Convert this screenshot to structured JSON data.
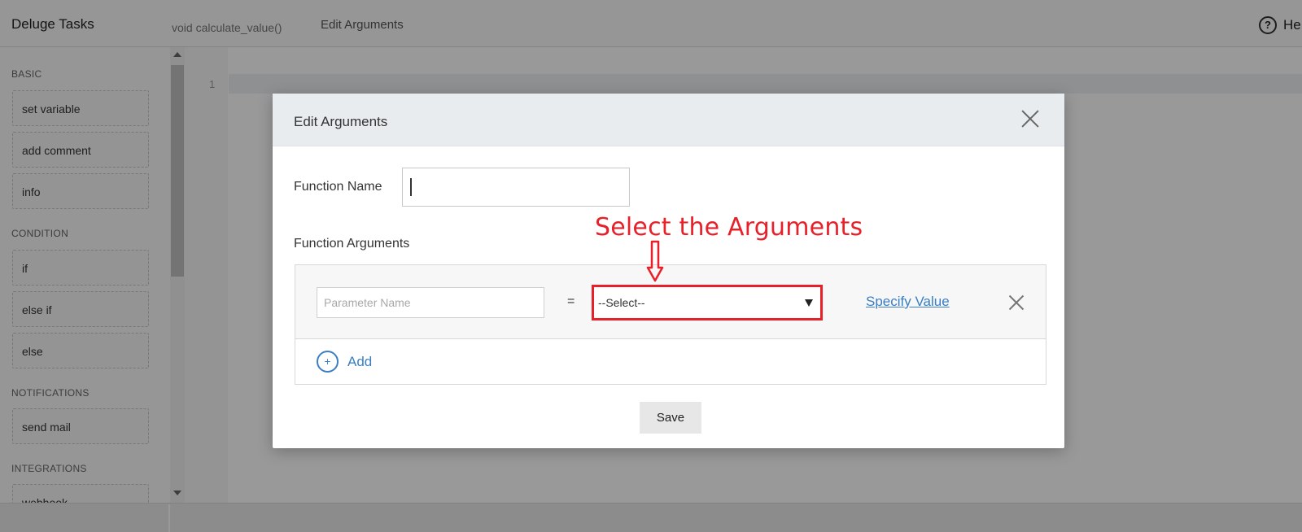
{
  "app": {
    "title": "Deluge Tasks",
    "function_signature": "void  calculate_value()",
    "active_tab": "Edit Arguments",
    "help_label": "He"
  },
  "sidebar": {
    "sections": [
      {
        "heading": "BASIC",
        "items": [
          "set variable",
          "add comment",
          "info"
        ]
      },
      {
        "heading": "CONDITION",
        "items": [
          "if",
          "else if",
          "else"
        ]
      },
      {
        "heading": "NOTIFICATIONS",
        "items": [
          "send mail"
        ]
      },
      {
        "heading": "INTEGRATIONS",
        "items": [
          "webhook"
        ]
      }
    ]
  },
  "editor": {
    "line_number": "1"
  },
  "modal": {
    "title": "Edit Arguments",
    "function_name_label": "Function Name",
    "function_name_value": "",
    "function_arguments_label": "Function Arguments",
    "argument_row": {
      "parameter_placeholder": "Parameter Name",
      "equals": "=",
      "select_value": "--Select--",
      "specify_value_link": "Specify Value"
    },
    "add_label": "Add",
    "add_icon": "+",
    "save_label": "Save"
  },
  "annotation": {
    "text": "Select the Arguments",
    "color": "#e8202a"
  },
  "colors": {
    "link_blue": "#3a7fc1",
    "highlight_red": "#e8202a"
  }
}
